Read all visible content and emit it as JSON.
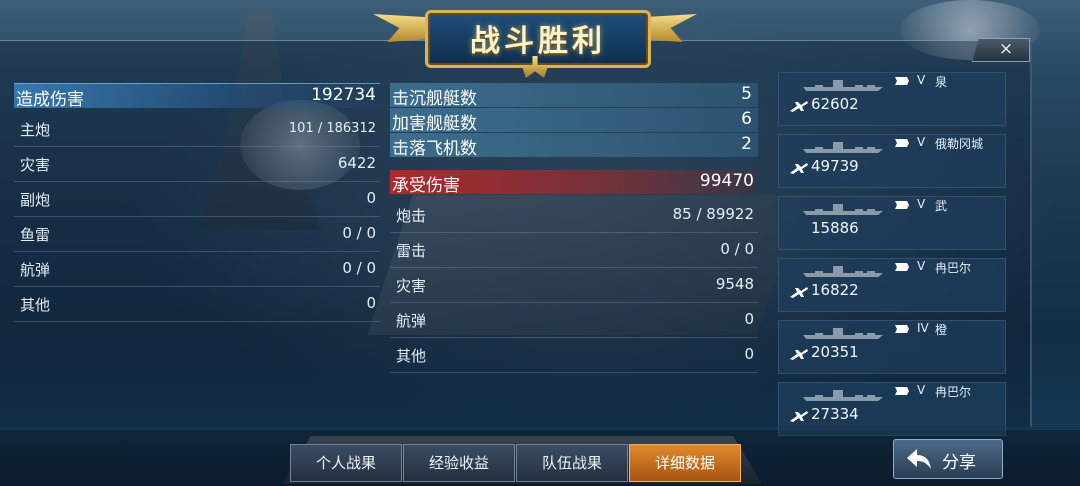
{
  "title": "战斗胜利",
  "close_label": "×",
  "damage_dealt": {
    "header": {
      "label": "造成伤害",
      "value": "192734"
    },
    "rows": [
      {
        "label": "主炮",
        "value": "101 / 186312"
      },
      {
        "label": "灾害",
        "value": "6422"
      },
      {
        "label": "副炮",
        "value": "0"
      },
      {
        "label": "鱼雷",
        "value": "0 / 0"
      },
      {
        "label": "航弹",
        "value": "0 / 0"
      },
      {
        "label": "其他",
        "value": "0"
      }
    ]
  },
  "kills": [
    {
      "label": "击沉舰艇数",
      "value": "5"
    },
    {
      "label": "加害舰艇数",
      "value": "6"
    },
    {
      "label": "击落飞机数",
      "value": "2"
    }
  ],
  "damage_taken": {
    "header": {
      "label": "承受伤害",
      "value": "99470"
    },
    "rows": [
      {
        "label": "炮击",
        "value": "85 / 89922"
      },
      {
        "label": "雷击",
        "value": "0 / 0"
      },
      {
        "label": "灾害",
        "value": "9548"
      },
      {
        "label": "航弹",
        "value": "0"
      },
      {
        "label": "其他",
        "value": "0"
      }
    ]
  },
  "ships": [
    {
      "tier": "V",
      "name": "泉",
      "damage": "62602",
      "show_icon": true
    },
    {
      "tier": "V",
      "name": "俄勒冈城",
      "damage": "49739",
      "show_icon": true
    },
    {
      "tier": "V",
      "name": "武",
      "damage": "15886",
      "show_icon": false
    },
    {
      "tier": "V",
      "name": "冉巴尔",
      "damage": "16822",
      "show_icon": true
    },
    {
      "tier": "IV",
      "name": "橙",
      "damage": "20351",
      "show_icon": true
    },
    {
      "tier": "V",
      "name": "冉巴尔",
      "damage": "27334",
      "show_icon": true
    }
  ],
  "tabs": [
    {
      "label": "个人战果",
      "active": false
    },
    {
      "label": "经验收益",
      "active": false
    },
    {
      "label": "队伍战果",
      "active": false
    },
    {
      "label": "详细数据",
      "active": true
    }
  ],
  "share_label": "分享",
  "colors": {
    "accent_orange": "#e08a2c",
    "header_blue": "#3c82be",
    "header_red": "#be2828",
    "banner_gold": "#d9b45a"
  }
}
